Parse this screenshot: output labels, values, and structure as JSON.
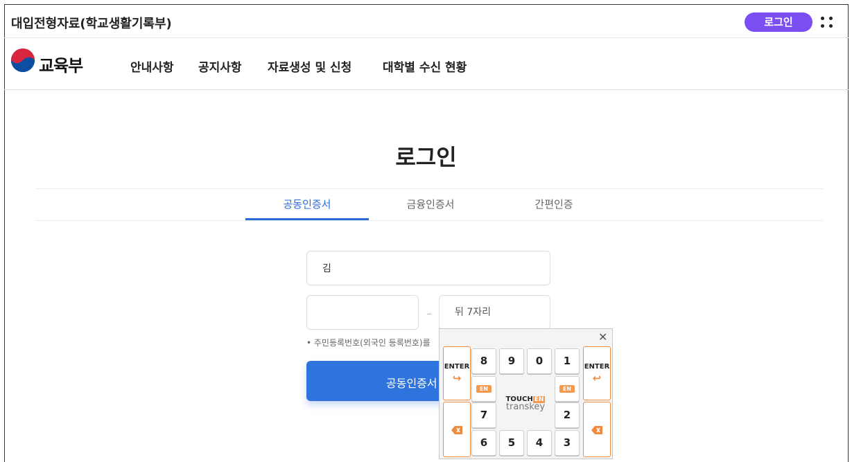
{
  "header": {
    "site_title": "대입전형자료(학교생활기록부)",
    "login_label": "로그인",
    "apps_icon": "grid-dots-icon"
  },
  "nav": {
    "logo_text": "교육부",
    "items": [
      "안내사항",
      "공지사항",
      "자료생성 및 신청",
      "대학별 수신 현황"
    ]
  },
  "main": {
    "title": "로그인",
    "tabs": [
      {
        "label": "공동인증서",
        "active": true
      },
      {
        "label": "금융인증서",
        "active": false
      },
      {
        "label": "간편인증",
        "active": false
      }
    ],
    "name_value": "김",
    "rrn_front_value": "",
    "rrn_back_placeholder": "뒤 7자리",
    "dash": "–",
    "notice": "• 주민등록번호(외국인 등록번호)를",
    "cert_button": "공동인증서"
  },
  "keypad": {
    "close": "✕",
    "row1": [
      "8",
      "9",
      "0",
      "1"
    ],
    "row3": [
      "7",
      "2"
    ],
    "row4": [
      "6",
      "5",
      "4",
      "3"
    ],
    "enter_label": "ENTER",
    "en_badge": "EN",
    "brand_top": "TOUCH",
    "brand_en": "EN",
    "brand_bottom": "transkey"
  },
  "colors": {
    "accent_purple": "#7a4ef2",
    "primary_blue": "#2f74de",
    "tab_blue": "#2a6bd8",
    "keypad_orange": "#f08a3c"
  }
}
